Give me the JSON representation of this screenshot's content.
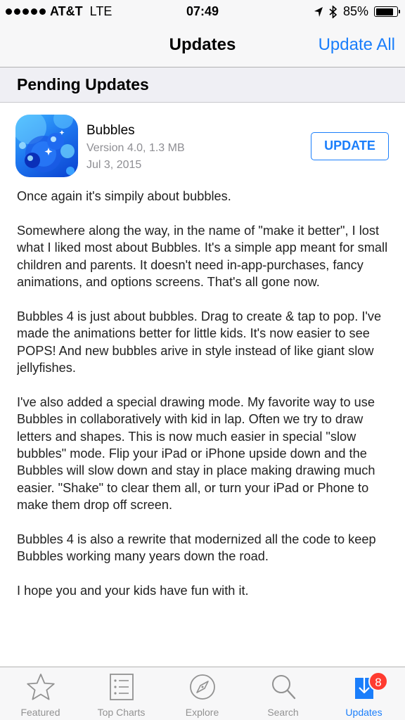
{
  "status_bar": {
    "carrier": "AT&T",
    "network": "LTE",
    "time": "07:49",
    "battery_percent": "85%",
    "battery_level": 0.85
  },
  "nav": {
    "title": "Updates",
    "action": "Update All"
  },
  "section": {
    "title": "Pending Updates"
  },
  "app": {
    "name": "Bubbles",
    "version": "Version 4.0, 1.3 MB",
    "date": "Jul 3, 2015",
    "button_label": "UPDATE"
  },
  "release_notes": [
    "Once again it's simpily about bubbles.",
    "Somewhere along the way, in the name of \"make it better\", I lost what I liked most about Bubbles. It's a simple app meant for small children and parents. It doesn't need in-app-purchases, fancy animations, and options screens. That's all gone now.",
    "Bubbles 4 is just about bubbles. Drag to create & tap to pop. I've made the animations better for little kids. It's now easier to see POPS! And new bubbles arive in style instead of like giant slow jellyfishes.",
    "I've also added a special drawing mode. My favorite way to use Bubbles in collaboratively with kid in lap. Often we try to draw letters and shapes. This is now much easier in special \"slow bubbles\" mode. Flip your iPad or iPhone upside down and the Bubbles will slow down and stay in place making drawing much easier. \"Shake\" to clear them all, or turn your iPad or Phone to make them drop off screen.",
    "Bubbles 4 is also a rewrite that modernized all the code to keep Bubbles working many years down the road.",
    "I hope you and your kids have fun with it."
  ],
  "tab_bar": {
    "tabs": [
      {
        "label": "Featured",
        "icon": "star-icon"
      },
      {
        "label": "Top Charts",
        "icon": "list-icon"
      },
      {
        "label": "Explore",
        "icon": "compass-icon"
      },
      {
        "label": "Search",
        "icon": "search-icon"
      },
      {
        "label": "Updates",
        "icon": "download-icon",
        "badge": "8",
        "active": true
      }
    ]
  },
  "colors": {
    "accent": "#1a7efb",
    "badge": "#ff3b30",
    "secondary_text": "#8e8e93"
  }
}
